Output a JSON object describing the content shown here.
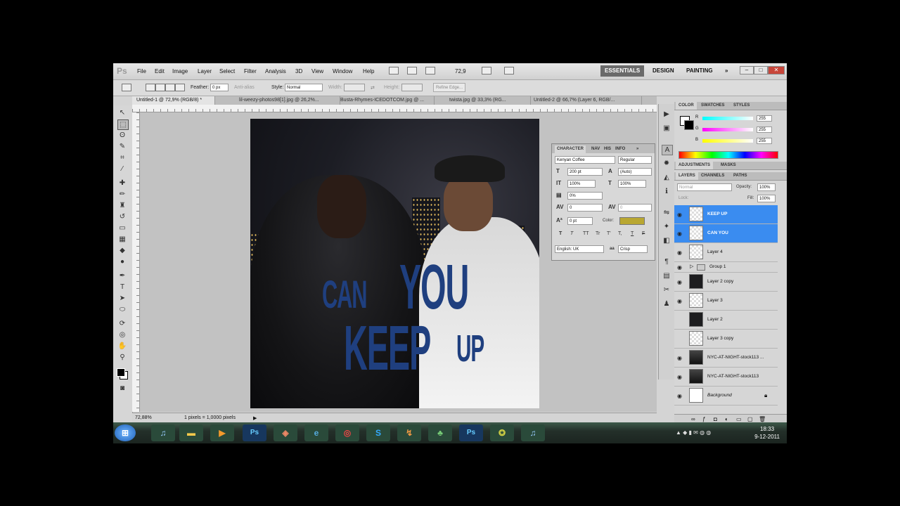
{
  "app": {
    "logo": "Ps"
  },
  "menu": [
    "File",
    "Edit",
    "Image",
    "Layer",
    "Select",
    "Filter",
    "Analysis",
    "3D",
    "View",
    "Window",
    "Help"
  ],
  "zoom": "72,9",
  "workspaces": [
    "ESSENTIALS",
    "DESIGN",
    "PAINTING",
    "»"
  ],
  "window_buttons": [
    "–",
    "□",
    "✕"
  ],
  "options": {
    "feather_label": "Feather:",
    "feather_value": "0 px",
    "anti_alias": "Anti-alias",
    "style_label": "Style:",
    "style_value": "Normal",
    "width_label": "Width:",
    "height_label": "Height:",
    "refine_edge": "Refine Edge..."
  },
  "tabs": [
    "Untitled-1 @ 72,9% (RGB/8) *",
    "lil-weezy-photos98[1].jpg @ 26,2%...",
    "Busta-Rhymes-ICEDOTCOM.jpg @ ...",
    "twista.jpg @ 33,3% (RG...",
    "Untitled-2 @ 66,7% (Layer 6, RGB/..."
  ],
  "artwork": {
    "line1a": "CAN",
    "line1b": "YOU",
    "line2a": "KEEP",
    "line2b": "UP",
    "text_color": "#1f3f7f"
  },
  "status": {
    "zoom": "72,88%",
    "info": "1 pixels = 1,0000 pixels"
  },
  "character": {
    "tabs": [
      "CHARACTER",
      "NAV",
      "HIS",
      "INFO"
    ],
    "font_family": "Kenyan Coffee",
    "font_style": "Regular",
    "size": "200 pt",
    "leading": "(Auto)",
    "vscale": "100%",
    "hscale": "100%",
    "tsume": "0%",
    "kerning": "0",
    "tracking": "0",
    "baseline": "0 pt",
    "color_label": "Color:",
    "color": "#b9a732",
    "styles": [
      "T",
      "T",
      "TT",
      "Tr",
      "T'",
      "T,",
      "T",
      "F"
    ],
    "language": "English: UK",
    "aa_label": "aa",
    "aa_value": "Crisp"
  },
  "color_panel": {
    "tabs": [
      "COLOR",
      "SWATCHES",
      "STYLES"
    ],
    "r_label": "R",
    "r": "255",
    "g_label": "G",
    "g": "255",
    "b_label": "B",
    "b": "255"
  },
  "adjust_tabs": [
    "ADJUSTMENTS",
    "MASKS"
  ],
  "layers_panel": {
    "tabs": [
      "LAYERS",
      "CHANNELS",
      "PATHS"
    ],
    "blend_mode": "Normal",
    "opacity_label": "Opacity:",
    "opacity": "100%",
    "lock_label": "Lock:",
    "fill_label": "Fill:",
    "fill": "100%",
    "layers": [
      {
        "name": "KEEP UP",
        "selected": true,
        "visible": true,
        "thumb": "text"
      },
      {
        "name": "CAN YOU",
        "selected": true,
        "visible": true,
        "thumb": "text"
      },
      {
        "name": "Layer 4",
        "selected": false,
        "visible": true,
        "thumb": "trans"
      },
      {
        "name": "Group 1",
        "selected": false,
        "visible": true,
        "thumb": "group"
      },
      {
        "name": "Layer 2 copy",
        "selected": false,
        "visible": true,
        "thumb": "dark"
      },
      {
        "name": "Layer 3",
        "selected": false,
        "visible": true,
        "thumb": "trans"
      },
      {
        "name": "Layer 2",
        "selected": false,
        "visible": false,
        "thumb": "dark"
      },
      {
        "name": "Layer 3 copy",
        "selected": false,
        "visible": false,
        "thumb": "trans"
      },
      {
        "name": "NYC-AT-NIGHT-stock113 ...",
        "selected": false,
        "visible": true,
        "thumb": "photo"
      },
      {
        "name": "NYC-AT-NIGHT-stock113",
        "selected": false,
        "visible": true,
        "thumb": "photo"
      },
      {
        "name": "Background",
        "selected": false,
        "visible": true,
        "thumb": "white"
      }
    ]
  },
  "taskbar": {
    "time": "18:33",
    "date": "9-12-2011"
  }
}
